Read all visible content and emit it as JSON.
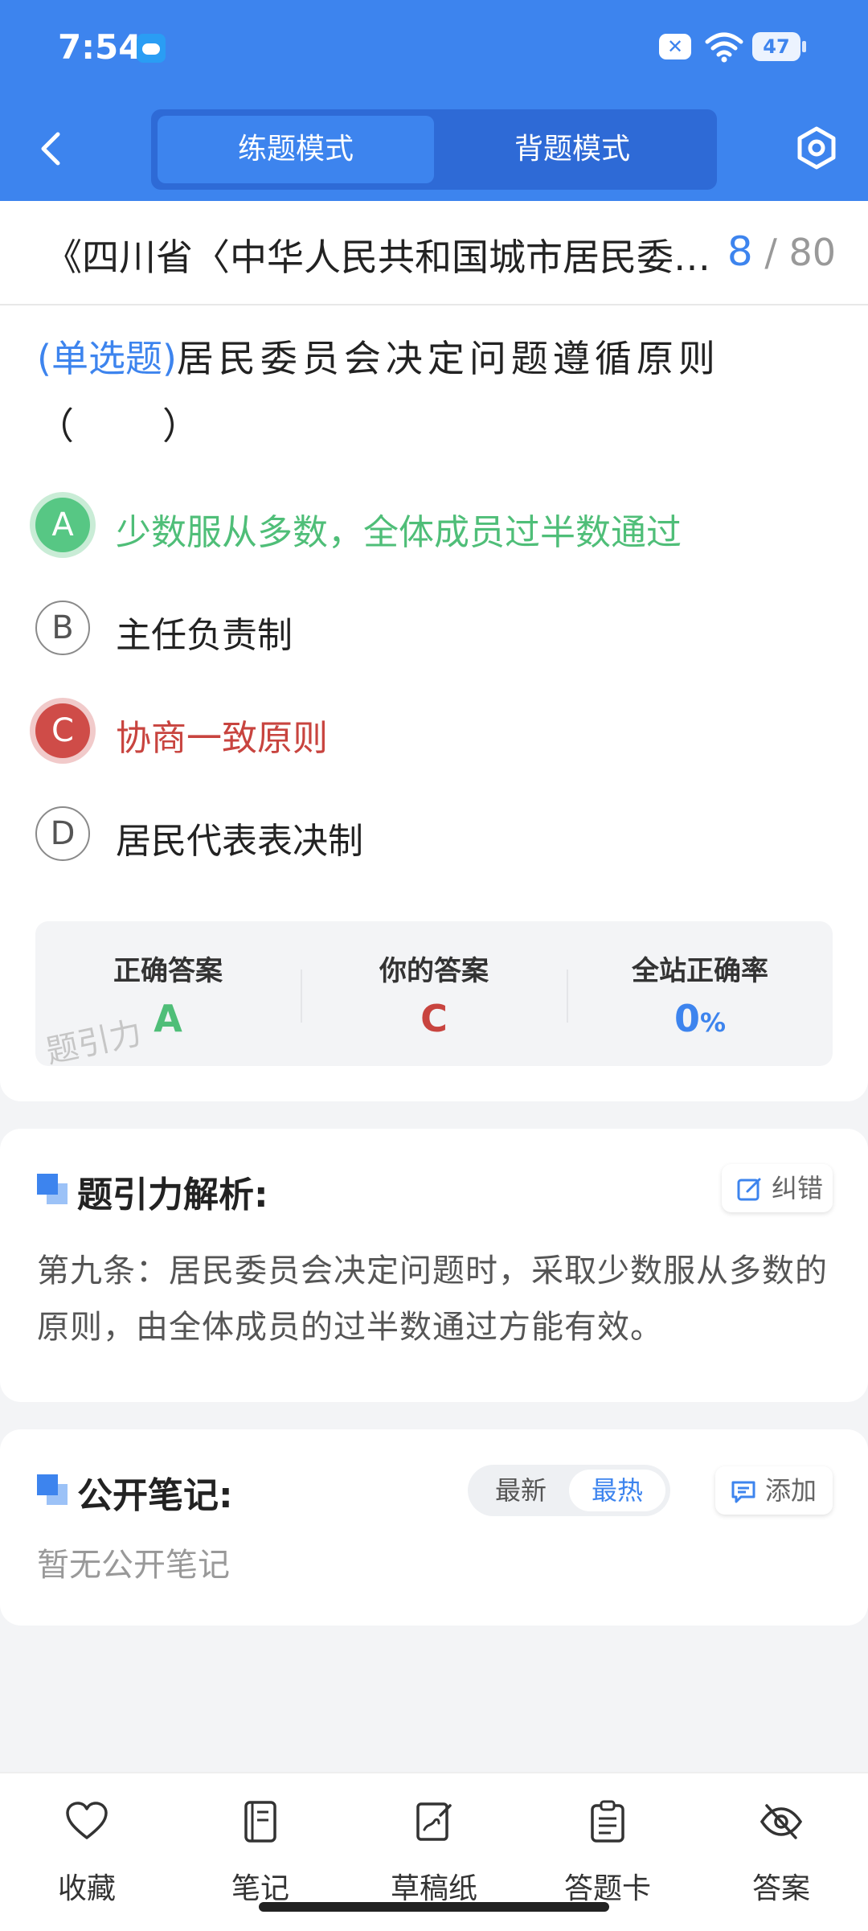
{
  "status_bar": {
    "time": "7:54",
    "battery": "47"
  },
  "header": {
    "tabs": [
      {
        "label": "练题模式"
      },
      {
        "label": "背题模式"
      }
    ]
  },
  "question": {
    "title": "《四川省〈中华人民共和国城市居民委员会组织法〉实施办法》",
    "current": "8",
    "total": "80",
    "type_label": "(单选题)",
    "text": "居民委员会决定问题遵循原则（　　）",
    "options": [
      {
        "letter": "A",
        "text": "少数服从多数，全体成员过半数通过",
        "state": "correct"
      },
      {
        "letter": "B",
        "text": "主任负责制",
        "state": "normal"
      },
      {
        "letter": "C",
        "text": "协商一致原则",
        "state": "wrong"
      },
      {
        "letter": "D",
        "text": "居民代表表决制",
        "state": "normal"
      }
    ]
  },
  "answer_summary": {
    "correct_label": "正确答案",
    "correct_value": "A",
    "yours_label": "你的答案",
    "yours_value": "C",
    "rate_label": "全站正确率",
    "rate_value": "0",
    "rate_unit": "%",
    "watermark": "题引力",
    "colors": {
      "correct": "#4fbe78",
      "wrong": "#c8443f",
      "accent": "#3d84ee"
    }
  },
  "analysis": {
    "title": "题引力解析:",
    "report_label": "纠错",
    "text": "第九条：居民委员会决定问题时，采取少数服从多数的原则，由全体成员的过半数通过方能有效。"
  },
  "notes": {
    "title": "公开笔记:",
    "sort_options": [
      "最新",
      "最热"
    ],
    "sort_selected": "最热",
    "add_label": "添加",
    "empty_text": "暂无公开笔记"
  },
  "bottom_bar": {
    "items": [
      {
        "label": "收藏",
        "icon": "heart-icon"
      },
      {
        "label": "笔记",
        "icon": "notebook-icon"
      },
      {
        "label": "草稿纸",
        "icon": "draft-paper-icon"
      },
      {
        "label": "答题卡",
        "icon": "answer-card-icon"
      },
      {
        "label": "答案",
        "icon": "eye-off-icon"
      }
    ]
  }
}
